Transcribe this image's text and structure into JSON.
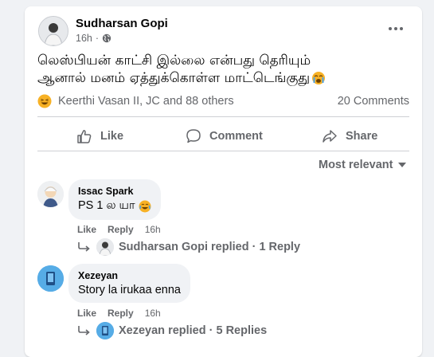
{
  "post": {
    "author_name": "Sudharsan Gopi",
    "time": "16h",
    "text_line1": "லெஸ்பியன் காட்சி இல்லை என்பது தெரியும்",
    "text_line2": "ஆனால் மனம் ஏத்துக்கொள்ள மாட்டெங்குது",
    "reactions_text": "Keerthi Vasan II, JC and 88 others",
    "comments_count": "20 Comments"
  },
  "actions": {
    "like": "Like",
    "comment": "Comment",
    "share": "Share"
  },
  "sort_label": "Most relevant",
  "comments": [
    {
      "name": "Issac Spark",
      "text": "PS 1 ல யா",
      "like": "Like",
      "reply": "Reply",
      "time": "16h",
      "replies_text": "Sudharsan Gopi replied · 1 Reply"
    },
    {
      "name": "Xezeyan",
      "text": "Story la irukaa enna",
      "like": "Like",
      "reply": "Reply",
      "time": "16h",
      "replies_text": "Xezeyan replied · 5 Replies"
    }
  ],
  "colors": {
    "secondary_text": "#65676b",
    "bubble": "#f0f2f5",
    "emoji_yellow": "#f7b125",
    "divider": "#ced0d4"
  }
}
